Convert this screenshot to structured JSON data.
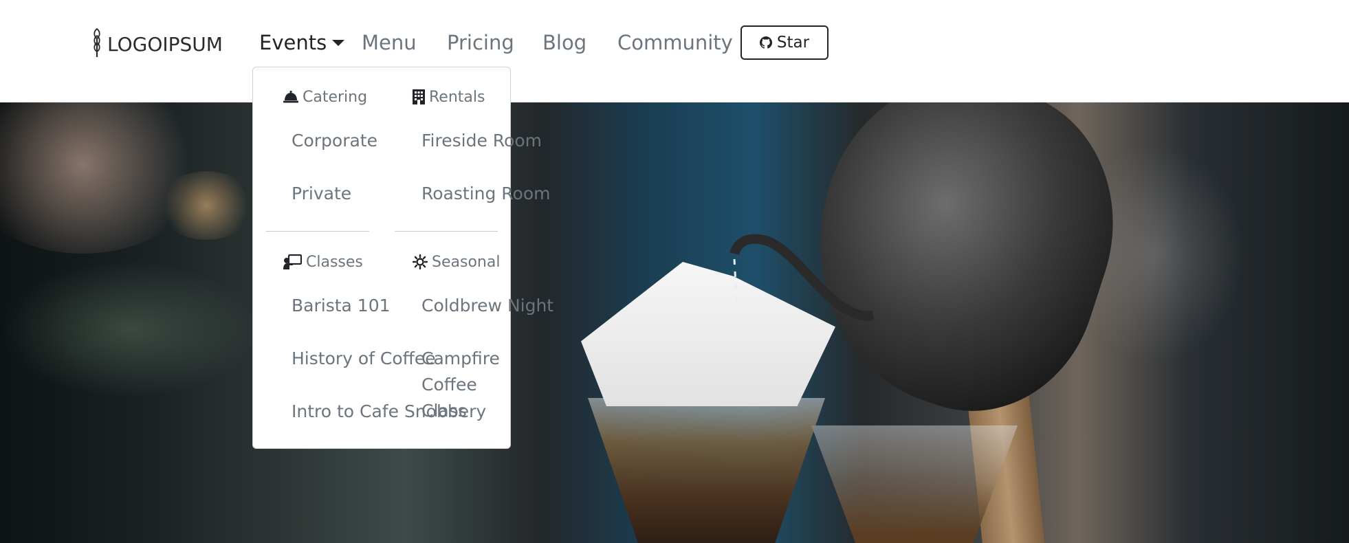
{
  "brand": {
    "logo_text": "LOGOIPSUM"
  },
  "nav": {
    "items": [
      {
        "label": "Events",
        "active": true
      },
      {
        "label": "Menu"
      },
      {
        "label": "Pricing"
      },
      {
        "label": "Blog"
      },
      {
        "label": "Community"
      }
    ],
    "star_button": {
      "label": "Star",
      "icon": "github-icon"
    }
  },
  "dropdown": {
    "sections": [
      {
        "header": "Catering",
        "icon": "bell-icon",
        "items": [
          "Corporate",
          "Private"
        ]
      },
      {
        "header": "Rentals",
        "icon": "building-icon",
        "items": [
          "Fireside Room",
          "Roasting Room"
        ]
      },
      {
        "header": "Classes",
        "icon": "chalkboard-teacher-icon",
        "items": [
          "Barista 101",
          "History of Coffee",
          "Intro to Cafe Snobbery"
        ]
      },
      {
        "header": "Seasonal",
        "icon": "sun-icon",
        "items": [
          "Coldbrew Night",
          "Campfire Coffee Class"
        ]
      }
    ]
  },
  "colors": {
    "muted_text": "#6c757d",
    "dark_text": "#212529",
    "border": "#212529"
  }
}
